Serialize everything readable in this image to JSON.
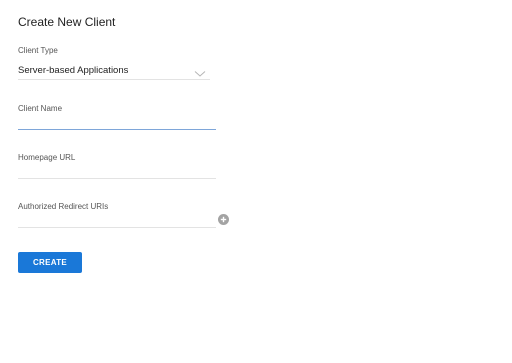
{
  "form": {
    "title": "Create New Client",
    "client_type": {
      "label": "Client Type",
      "selected": "Server-based Applications",
      "icon": "chevron-down-icon"
    },
    "client_name": {
      "label": "Client Name",
      "value": "",
      "active": true
    },
    "homepage_url": {
      "label": "Homepage URL",
      "value": ""
    },
    "redirect_uris": {
      "label": "Authorized Redirect URIs",
      "value": "",
      "add_icon": "plus-circle-icon"
    },
    "create_label": "CREATE"
  },
  "colors": {
    "accent": "#1a78d8",
    "active_underline": "#7ea6d9",
    "underline": "#e3e3e3",
    "add_icon_bg": "#a3a3a3"
  }
}
